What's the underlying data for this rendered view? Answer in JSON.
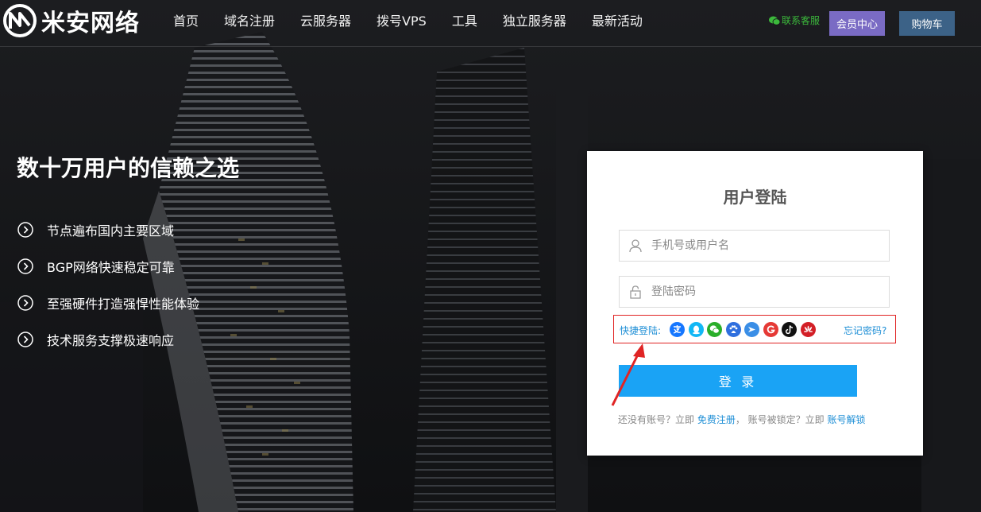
{
  "logo": {
    "text": "米安网络"
  },
  "nav": {
    "items": [
      {
        "label": "首页"
      },
      {
        "label": "域名注册"
      },
      {
        "label": "云服务器"
      },
      {
        "label": "拨号VPS"
      },
      {
        "label": "工具"
      },
      {
        "label": "独立服务器"
      },
      {
        "label": "最新活动"
      }
    ]
  },
  "header": {
    "contact_label": "联系客服",
    "member_label": "会员中心",
    "cart_label": "购物车"
  },
  "hero": {
    "title": "数十万用户的信赖之选",
    "features": [
      {
        "label": "节点遍布国内主要区域"
      },
      {
        "label": "BGP网络快速稳定可靠"
      },
      {
        "label": "至强硬件打造强悍性能体验"
      },
      {
        "label": "技术服务支撑极速响应"
      }
    ]
  },
  "login": {
    "title": "用户登陆",
    "username_placeholder": "手机号或用户名",
    "password_placeholder": "登陆密码",
    "quick_label": "快捷登陆:",
    "social_icons": [
      "alipay-icon",
      "qq-icon",
      "wechat-icon",
      "baidu-icon",
      "feishu-icon",
      "google-icon",
      "tiktok-icon",
      "huawei-icon"
    ],
    "forgot_label": "忘记密码?",
    "submit_label": "登 录",
    "no_account_text": "还没有账号？立即",
    "register_label": "免费注册",
    "locked_text": "， 账号被锁定？立即",
    "unlock_label": "账号解锁"
  },
  "colors": {
    "accent": "#1aa3f5",
    "member_button": "#7a6bc4",
    "cart_button": "#3c6287",
    "contact_green": "#3cb93c",
    "highlight_red": "#e02424"
  }
}
